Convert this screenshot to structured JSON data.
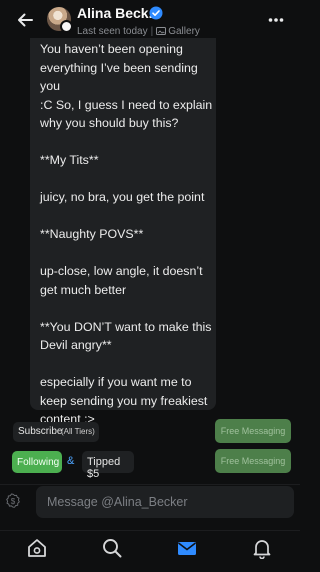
{
  "header": {
    "name": "Alina Beck...",
    "status": "Last seen today",
    "gallery_label": "Gallery"
  },
  "message": {
    "paragraphs": [
      "You haven’t been opening\neverything I’ve been sending you\n:C So, I guess I need to explain\nwhy you should buy this?",
      "**My Tits**",
      "juicy, no bra, you get the point",
      "**Naughty POVS**",
      "up-close, low angle, it doesn’t\nget much better",
      "**You DON’T want to make this\nDevil angry**",
      "especially if you want me to\nkeep sending you my freakiest\ncontent :>"
    ]
  },
  "actions": {
    "subscribe_label": "Subscribe",
    "subscribe_tier": "(All Tiers)",
    "free_messaging_1": "Free Messaging",
    "free_messaging_2": "Free Messaging",
    "following_label": "Following",
    "amp": "&",
    "tipped_label": "Tipped $5"
  },
  "composer": {
    "placeholder": "Message @Alina_Becker"
  },
  "colors": {
    "background": "#0e0f10",
    "bubble": "#1f2123",
    "accent_blue": "#2f8bff",
    "green": "#4caf50",
    "green_muted": "#4d7f4a"
  },
  "icons": [
    "back-arrow-icon",
    "verified-badge-icon",
    "gallery-icon",
    "more-icon",
    "dollar-icon",
    "home-icon",
    "search-icon",
    "messages-icon",
    "bell-icon"
  ]
}
